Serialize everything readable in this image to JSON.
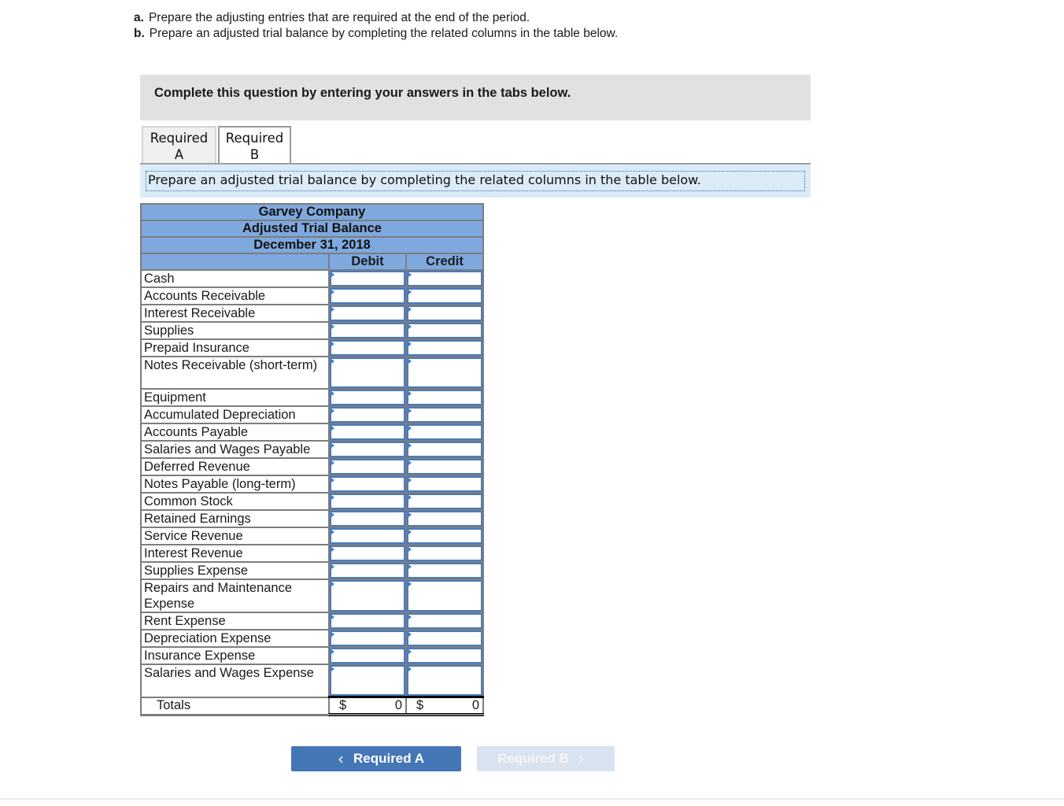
{
  "instructions": [
    {
      "marker": "a.",
      "text": "Prepare the adjusting entries that are required at the end of the period."
    },
    {
      "marker": "b.",
      "text": "Prepare an adjusted trial balance by completing the related columns in the table below."
    }
  ],
  "banner": "Complete this question by entering your answers in the tabs below.",
  "tabs": [
    {
      "line1": "Required",
      "line2": "A",
      "active": false
    },
    {
      "line1": "Required",
      "line2": "B",
      "active": true
    }
  ],
  "prompt": "Prepare an adjusted trial balance by completing the related columns in the table below.",
  "table": {
    "company": "Garvey Company",
    "title": "Adjusted Trial Balance",
    "date": "December 31, 2018",
    "col_debit": "Debit",
    "col_credit": "Credit",
    "accounts": [
      {
        "name": "Cash",
        "debit": "",
        "credit": ""
      },
      {
        "name": "Accounts Receivable",
        "debit": "",
        "credit": ""
      },
      {
        "name": "Interest Receivable",
        "debit": "",
        "credit": ""
      },
      {
        "name": "Supplies",
        "debit": "",
        "credit": ""
      },
      {
        "name": "Prepaid Insurance",
        "debit": "",
        "credit": ""
      },
      {
        "name": "Notes Receivable (short-term)",
        "debit": "",
        "credit": ""
      },
      {
        "name": "Equipment",
        "debit": "",
        "credit": ""
      },
      {
        "name": "Accumulated Depreciation",
        "debit": "",
        "credit": ""
      },
      {
        "name": "Accounts Payable",
        "debit": "",
        "credit": ""
      },
      {
        "name": "Salaries and Wages Payable",
        "debit": "",
        "credit": ""
      },
      {
        "name": "Deferred Revenue",
        "debit": "",
        "credit": ""
      },
      {
        "name": "Notes Payable (long-term)",
        "debit": "",
        "credit": ""
      },
      {
        "name": "Common Stock",
        "debit": "",
        "credit": ""
      },
      {
        "name": "Retained Earnings",
        "debit": "",
        "credit": ""
      },
      {
        "name": "Service Revenue",
        "debit": "",
        "credit": ""
      },
      {
        "name": "Interest Revenue",
        "debit": "",
        "credit": ""
      },
      {
        "name": "Supplies Expense",
        "debit": "",
        "credit": ""
      },
      {
        "name": "Repairs and Maintenance Expense",
        "debit": "",
        "credit": ""
      },
      {
        "name": "Rent Expense",
        "debit": "",
        "credit": ""
      },
      {
        "name": "Depreciation Expense",
        "debit": "",
        "credit": ""
      },
      {
        "name": "Insurance Expense",
        "debit": "",
        "credit": ""
      },
      {
        "name": "Salaries and Wages Expense",
        "debit": "",
        "credit": ""
      }
    ],
    "totals": {
      "label": "Totals",
      "currency": "$",
      "debit": "0",
      "credit": "0"
    }
  },
  "nav": {
    "prev_label": "Required A",
    "next_label": "Required B",
    "prev_icon": "chevron-left-icon",
    "next_icon": "chevron-right-icon"
  }
}
